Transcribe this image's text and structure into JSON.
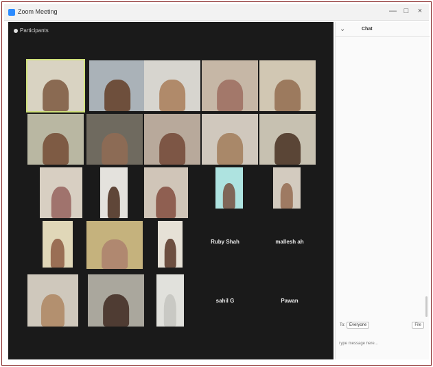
{
  "window": {
    "title": "Zoom Meeting",
    "app_icon": "zoom-icon",
    "controls": [
      "—",
      "□",
      "×"
    ]
  },
  "video_panel": {
    "label": "Participants",
    "view_icon": "grid-icon"
  },
  "tiles": [
    {
      "name": "",
      "bg": "#d9d3c2",
      "skin": "#8a6a52",
      "active": true
    },
    {
      "name": "",
      "bg": "#aab2b8",
      "skin": "#6e4f3c"
    },
    {
      "name": "",
      "bg": "#d7d5cf",
      "skin": "#b08a6a"
    },
    {
      "name": "",
      "bg": "#c6b7a6",
      "skin": "#a3786a"
    },
    {
      "name": "",
      "bg": "#d1c7b3",
      "skin": "#9c7a5e"
    },
    {
      "name": "",
      "bg": "#b9b7a2",
      "skin": "#7e5b44"
    },
    {
      "name": "",
      "bg": "#6f6a5f",
      "skin": "#8c6b55"
    },
    {
      "name": "",
      "bg": "#b8a99b",
      "skin": "#7d5645"
    },
    {
      "name": "",
      "bg": "#d0c8bd",
      "skin": "#a98869"
    },
    {
      "name": "",
      "bg": "#c7c1b1",
      "skin": "#5a4536"
    },
    {
      "name": "",
      "bg": "#d8cfc2",
      "skin": "#a0736d"
    },
    {
      "name": "",
      "bg": "#e4e2dd",
      "skin": "#5f4638"
    },
    {
      "name": "",
      "bg": "#d0c5b8",
      "skin": "#8f5f51"
    },
    {
      "name": "",
      "bg": "#aee3e0",
      "skin": "#7f6658"
    },
    {
      "name": "",
      "bg": "#d3cbbf",
      "skin": "#9e7a62"
    },
    {
      "name": "",
      "bg": "#e0d7b8",
      "skin": "#9a6f55"
    },
    {
      "name": "",
      "bg": "#c5b27d",
      "skin": "#b08870"
    },
    {
      "name": "",
      "bg": "#e6e1d6",
      "skin": "#6d4f40"
    },
    {
      "name": "",
      "bg": "#cfc8bc",
      "skin": "#b3906f"
    },
    {
      "name": "",
      "bg": "#aaa79d",
      "skin": "#4f3c33"
    },
    {
      "name": "",
      "bg": "#e1e1dc",
      "skin": "#c9c9c4"
    }
  ],
  "text_tiles": [
    {
      "label": "Ruby Shah"
    },
    {
      "label": "mallesh ah"
    },
    {
      "label": "sahil G"
    },
    {
      "label": "Pawan"
    }
  ],
  "chat": {
    "title": "Chat",
    "collapse_icon": "chevron-down-icon",
    "messages": [],
    "to_label": "To:",
    "to_value": "Everyone",
    "file_label": "File",
    "input_placeholder": "Type message here..."
  }
}
